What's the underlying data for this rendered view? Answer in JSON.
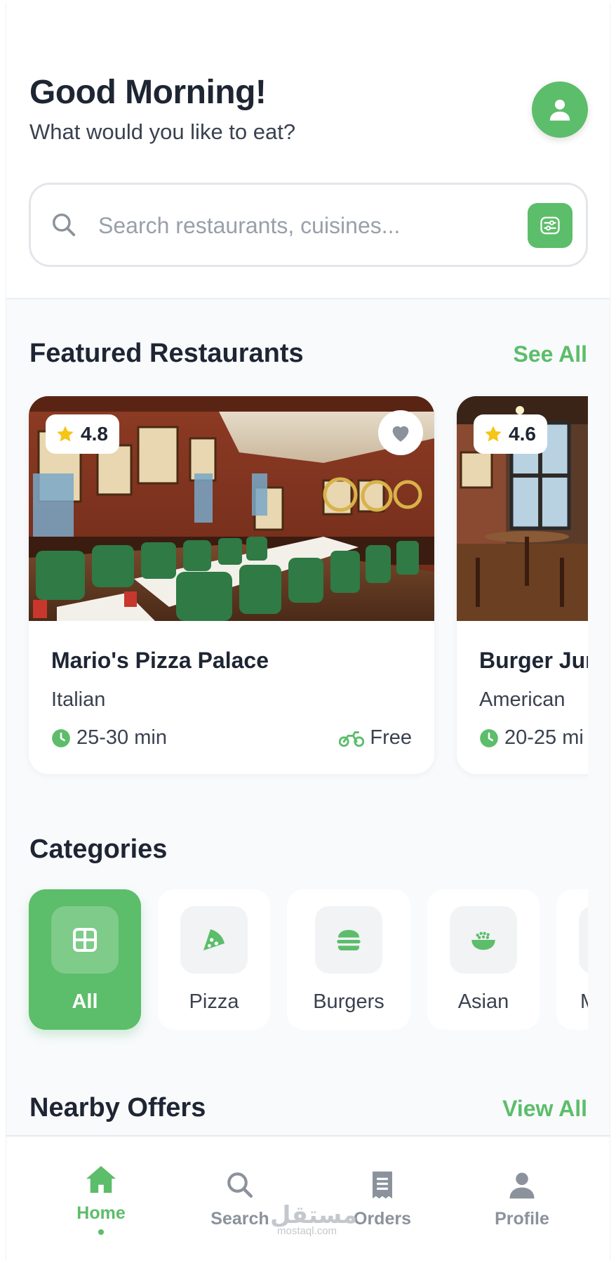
{
  "header": {
    "greeting": "Good Morning!",
    "subtitle": "What would you like to eat?"
  },
  "search": {
    "placeholder": "Search restaurants, cuisines..."
  },
  "featured": {
    "title": "Featured Restaurants",
    "link": "See All",
    "restaurants": [
      {
        "name": "Mario's Pizza Palace",
        "cuisine": "Italian",
        "rating": "4.8",
        "time": "25-30 min",
        "delivery": "Free"
      },
      {
        "name": "Burger Jur",
        "cuisine": "American",
        "rating": "4.6",
        "time": "20-25 mi"
      }
    ]
  },
  "categories": {
    "title": "Categories",
    "items": [
      {
        "label": "All",
        "icon": "grid-icon",
        "active": true
      },
      {
        "label": "Pizza",
        "icon": "pizza-icon"
      },
      {
        "label": "Burgers",
        "icon": "burger-icon"
      },
      {
        "label": "Asian",
        "icon": "rice-bowl-icon"
      },
      {
        "label": "M",
        "icon": "category-icon"
      }
    ]
  },
  "offers": {
    "title": "Nearby Offers",
    "link": "View All"
  },
  "nav": {
    "items": [
      {
        "label": "Home",
        "icon": "home-icon",
        "active": true
      },
      {
        "label": "Search",
        "icon": "search-icon"
      },
      {
        "label": "Orders",
        "icon": "receipt-icon"
      },
      {
        "label": "Profile",
        "icon": "user-icon"
      }
    ]
  },
  "watermark": {
    "text": "مستقل",
    "sub": "mostaql.com"
  },
  "colors": {
    "accent": "#5cbd6a",
    "text_dark": "#1e2533",
    "star": "#f5c518"
  }
}
